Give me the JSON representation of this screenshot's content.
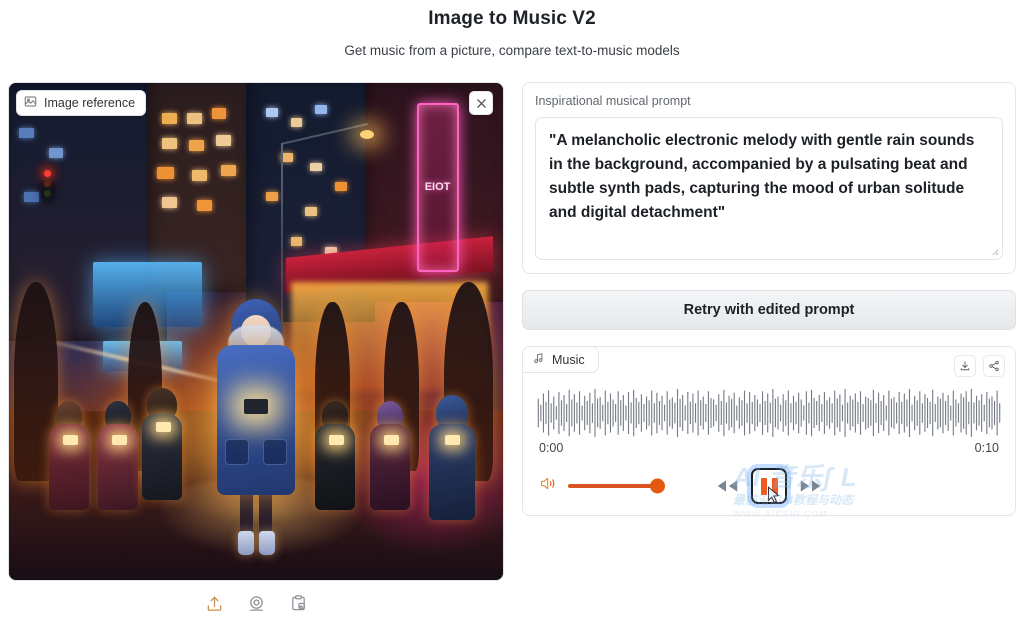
{
  "header": {
    "title": "Image to Music V2",
    "subtitle": "Get music from a picture, compare text-to-music models"
  },
  "image_reference": {
    "badge_label": "Image reference",
    "badge_icon": "image-icon",
    "close_icon": "close-icon",
    "scene_description": "Night city street, crowd of people looking at glowing phones, neon signs, wet reflective pavement",
    "neon_sign_text": "EIOT",
    "tools": [
      {
        "name": "upload-icon",
        "label": "Upload"
      },
      {
        "name": "webcam-icon",
        "label": "Webcam"
      },
      {
        "name": "clipboard-icon",
        "label": "Paste from clipboard"
      }
    ]
  },
  "prompt": {
    "label": "Inspirational musical prompt",
    "value": "\"A melancholic electronic melody with gentle rain sounds in the background, accompanied by a pulsating beat and subtle synth pads, capturing the mood of urban solitude and digital detachment\"",
    "placeholder": "Inspirational musical prompt"
  },
  "retry": {
    "label": "Retry with edited prompt"
  },
  "music": {
    "tab_label": "Music",
    "tab_icon": "music-note-icon",
    "actions": [
      {
        "name": "download-icon",
        "label": "Download"
      },
      {
        "name": "share-icon",
        "label": "Share"
      }
    ],
    "time_start": "0:00",
    "time_end": "0:10",
    "volume_percent": 100,
    "playing": true,
    "transport": {
      "rewind_label": "Skip backward",
      "play_pause_label": "Pause",
      "forward_label": "Skip forward"
    },
    "waveform": [
      38,
      22,
      52,
      30,
      60,
      26,
      44,
      18,
      56,
      34,
      48,
      24,
      62,
      36,
      50,
      28,
      58,
      20,
      46,
      32,
      54,
      26,
      64,
      38,
      42,
      22,
      60,
      30,
      52,
      36,
      24,
      58,
      34,
      48,
      20,
      56,
      28,
      62,
      40,
      30,
      50,
      24,
      44,
      34,
      60,
      26,
      54,
      32,
      46,
      22,
      58,
      36,
      42,
      28,
      64,
      38,
      48,
      20,
      56,
      30,
      52,
      26,
      60,
      34,
      44,
      24,
      58,
      40,
      36,
      22,
      50,
      32,
      62,
      28,
      46,
      38,
      54,
      20,
      42,
      34,
      60,
      26,
      56,
      30,
      48,
      36,
      24,
      58,
      32,
      52,
      28,
      64,
      38,
      44,
      22,
      50,
      34,
      60,
      26,
      46,
      30,
      54,
      36,
      20,
      58,
      28,
      62,
      40,
      32,
      48,
      24,
      56,
      34,
      42,
      26,
      60,
      38,
      50,
      22,
      64,
      28,
      46,
      36,
      52,
      30,
      58,
      24,
      44,
      40,
      34,
      62,
      26,
      54,
      32,
      48,
      20,
      60,
      38,
      42,
      28,
      56,
      30,
      52,
      36,
      64,
      22,
      46,
      34,
      58,
      26,
      50,
      40,
      30,
      62,
      24,
      44,
      38,
      54,
      32,
      48,
      20,
      60,
      36,
      26,
      52,
      42,
      58,
      30,
      64,
      28,
      46,
      34,
      50,
      22,
      56,
      38,
      44,
      32,
      60,
      26
    ],
    "watermark": {
      "line1": "AI 音乐ʃ L",
      "line2": "最前沿口AI教程与动态",
      "line3": "WWW.AIESHI.COM"
    }
  },
  "colors": {
    "accent_orange": "#e2590f",
    "play_bar": "#f05a22",
    "focus_ring": "rgba(120,180,255,.45)",
    "panel_border": "#e4e6e9",
    "text_primary": "#1d2126",
    "text_muted": "#62686f"
  }
}
